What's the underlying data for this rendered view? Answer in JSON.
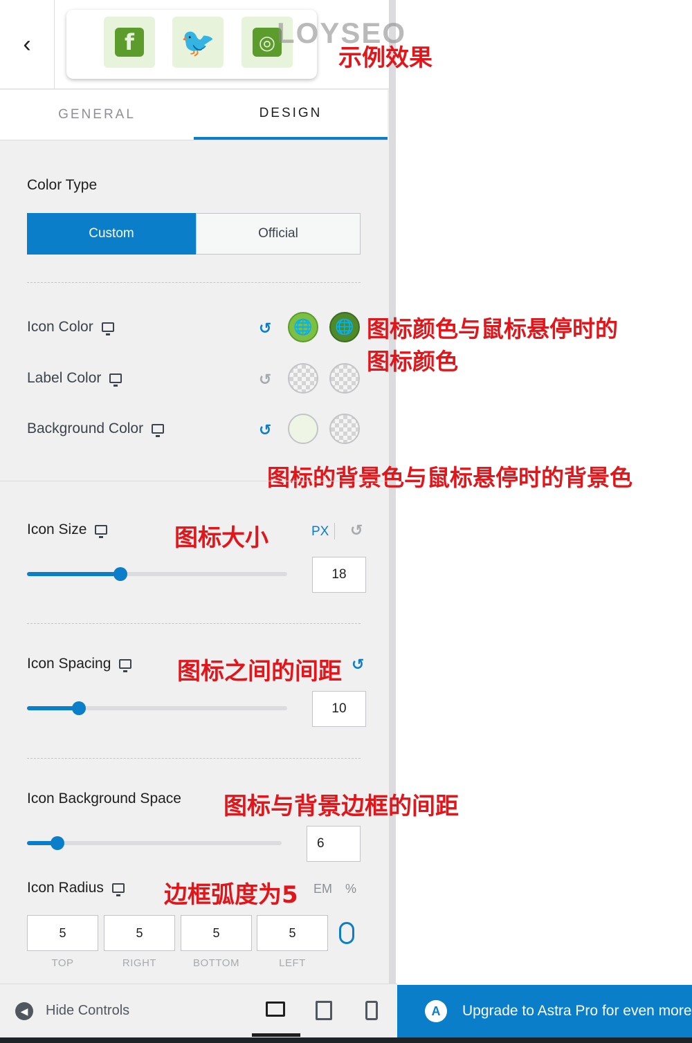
{
  "watermark": "LOYSEO",
  "preview": {
    "icons": [
      "facebook-icon",
      "twitter-icon",
      "instagram-icon"
    ],
    "icon_color": "#5b9c2c",
    "icon_bg": "#e8f3dc"
  },
  "annotations": {
    "example_effect": "示例效果",
    "icon_color_note_line1": "图标颜色与鼠标悬停时的",
    "icon_color_note_line2": "图标颜色",
    "bg_color_note": "图标的背景色与鼠标悬停时的背景色",
    "icon_size_note": "图标大小",
    "icon_spacing_note": "图标之间的间距",
    "icon_bg_space_note": "图标与背景边框的间距",
    "icon_radius_note": "边框弧度为5"
  },
  "tabs": {
    "general": "GENERAL",
    "design": "DESIGN",
    "active": "design"
  },
  "color_type": {
    "label": "Color Type",
    "options": [
      "Custom",
      "Official"
    ],
    "selected": "Custom"
  },
  "colors": {
    "icon_color": {
      "label": "Icon Color",
      "normal": "#7bc043",
      "hover": "#4f8a2a"
    },
    "label_color": {
      "label": "Label Color"
    },
    "background_color": {
      "label": "Background Color",
      "normal": "#eef5e4"
    }
  },
  "icon_size": {
    "label": "Icon Size",
    "unit": "PX",
    "value": "18",
    "fraction": 0.36
  },
  "icon_spacing": {
    "label": "Icon Spacing",
    "value": "10",
    "fraction": 0.2
  },
  "icon_bg_space": {
    "label": "Icon Background Space",
    "value": "6",
    "fraction": 0.12
  },
  "icon_radius": {
    "label": "Icon Radius",
    "units": [
      "EM",
      "%"
    ],
    "values": {
      "top": "5",
      "right": "5",
      "bottom": "5",
      "left": "5"
    },
    "captions": {
      "top": "TOP",
      "right": "RIGHT",
      "bottom": "BOTTOM",
      "left": "LEFT"
    }
  },
  "footer": {
    "hide_controls": "Hide Controls",
    "upgrade": "Upgrade to Astra Pro for even more"
  },
  "accent_color": "#0a7ec8"
}
